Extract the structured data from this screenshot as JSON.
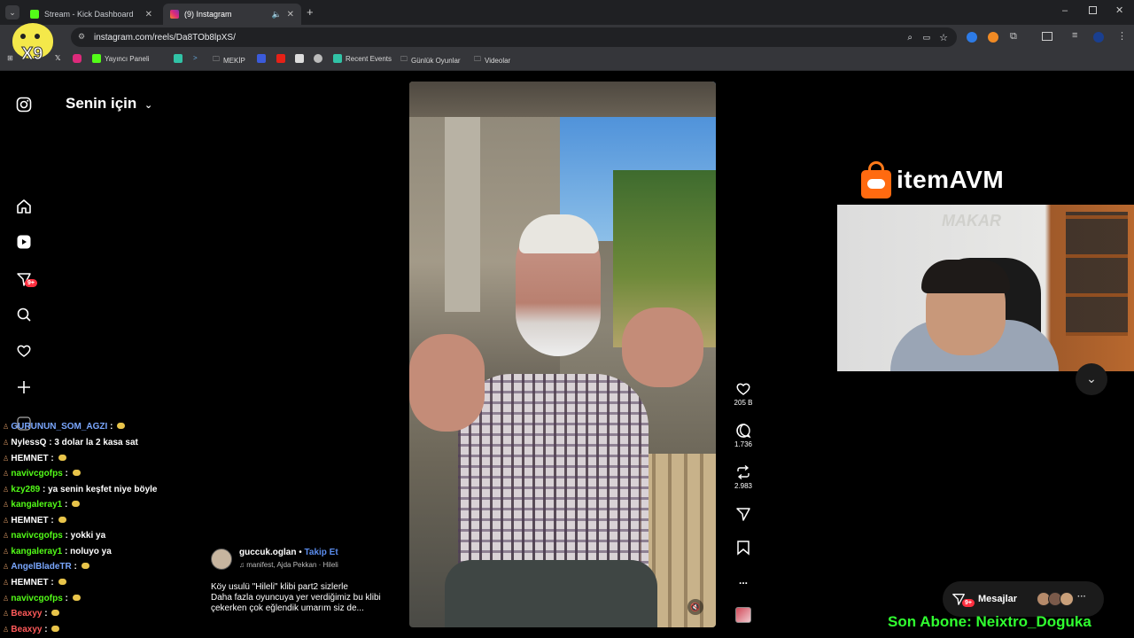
{
  "browser": {
    "tabs": [
      {
        "title": "Stream - Kick Dashboard",
        "icon": "kick-icon",
        "color": "#53fc18"
      },
      {
        "title": "(9) Instagram",
        "icon": "instagram-icon",
        "color": "#d6249f"
      }
    ],
    "url": "instagram.com/reels/Da8TOb8lpXS/",
    "bookmarks": [
      "Yayıncı Paneli",
      "MEKİP",
      "Recent Events",
      "Günlük Oyunlar",
      "Videolar"
    ]
  },
  "instagram": {
    "feed_title": "Senin için",
    "notification_badge": "9+",
    "reel": {
      "username": "guccuk.oglan",
      "follow_label": "Takip Et",
      "audio": "manifest, Ajda Pekkan · Hileli",
      "caption_lines": [
        "Köy usulü \"Hileli\" klibi part2 sizlerle",
        "Daha fazla oyuncuya yer verdiğimiz bu klibi",
        "çekerken çok eğlendik umarım siz de..."
      ],
      "likes": "205 B",
      "comments": "1.736",
      "reposts": "2.983",
      "more": "..."
    },
    "messages": {
      "label": "Mesajlar",
      "badge": "9+"
    }
  },
  "overlay": {
    "sponsor": "itemAVM",
    "last_sub_label": "Son Abone: Neixtro_Doguka",
    "chat": [
      {
        "user": "GURUNUN_SOM_AGZI",
        "msg": "",
        "emoji": true,
        "ucolor": "#7aa7ff"
      },
      {
        "user": "NylessQ",
        "msg": "3 dolar la 2 kasa sat",
        "emoji": false,
        "ucolor": "#ffffff"
      },
      {
        "user": "HEMNET",
        "msg": "",
        "emoji": true,
        "ucolor": "#ffffff"
      },
      {
        "user": "navivcgofps",
        "msg": "",
        "emoji": true,
        "ucolor": "#53fc18"
      },
      {
        "user": "kzy289",
        "msg": "ya senin keşfet niye böyle",
        "emoji": false,
        "ucolor": "#53fc18"
      },
      {
        "user": "kangaleray1",
        "msg": "",
        "emoji": true,
        "ucolor": "#53fc18"
      },
      {
        "user": "HEMNET",
        "msg": "",
        "emoji": true,
        "ucolor": "#ffffff"
      },
      {
        "user": "navivcgofps",
        "msg": "yokki ya",
        "emoji": false,
        "ucolor": "#53fc18"
      },
      {
        "user": "kangaleray1",
        "msg": "noluyo ya",
        "emoji": false,
        "ucolor": "#53fc18"
      },
      {
        "user": "AngelBladeTR",
        "msg": "",
        "emoji": true,
        "ucolor": "#7aa7ff"
      },
      {
        "user": "HEMNET",
        "msg": "",
        "emoji": true,
        "ucolor": "#ffffff"
      },
      {
        "user": "navivcgofps",
        "msg": "",
        "emoji": true,
        "ucolor": "#53fc18"
      },
      {
        "user": "Beaxyy",
        "msg": "",
        "emoji": true,
        "ucolor": "#ff5a5a"
      },
      {
        "user": "Beaxyy",
        "msg": "",
        "emoji": true,
        "ucolor": "#ff5a5a"
      }
    ]
  }
}
